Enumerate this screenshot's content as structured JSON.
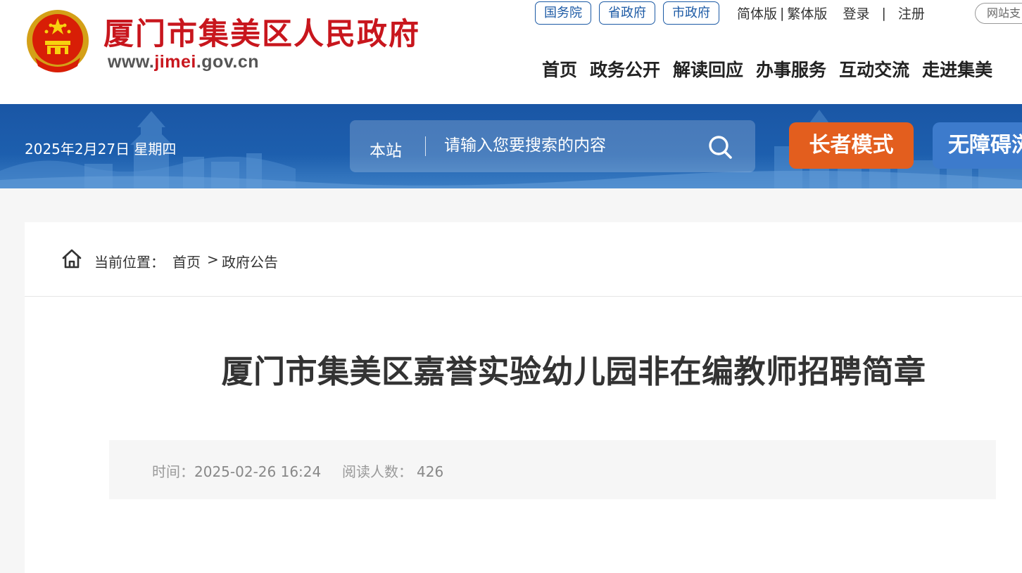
{
  "header": {
    "site_title": "厦门市集美区人民政府",
    "url_prefix": "www.",
    "url_highlight": "jimei",
    "url_suffix": ".gov.cn",
    "top_links": {
      "gov_council": "国务院",
      "province_gov": "省政府",
      "city_gov": "市政府",
      "simplified": "简体版",
      "separator": "|",
      "traditional": "繁体版",
      "login": "登录",
      "register": "注册",
      "site_button": "网站支"
    },
    "nav": [
      "首页",
      "政务公开",
      "解读回应",
      "办事服务",
      "互动交流",
      "走进集美"
    ]
  },
  "banner": {
    "date": "2025年2月27日 星期四",
    "search_scope": "本站",
    "search_placeholder": "请输入您要搜索的内容",
    "elder_mode": "长者模式",
    "accessibility": "无障碍浏览"
  },
  "breadcrumb": {
    "label": "当前位置：",
    "home": "首页",
    "separator": ">",
    "current": "政府公告"
  },
  "article": {
    "title": "厦门市集美区嘉誉实验幼儿园非在编教师招聘简章",
    "time_label": "时间：",
    "time_value": "2025-02-26 16:24",
    "reads_label": "阅读人数：",
    "reads_value": "426"
  },
  "colors": {
    "brand_red": "#c8161d",
    "brand_blue": "#1c5aa5",
    "elder_orange": "#e35e1e",
    "access_blue": "#3d7bcc"
  }
}
